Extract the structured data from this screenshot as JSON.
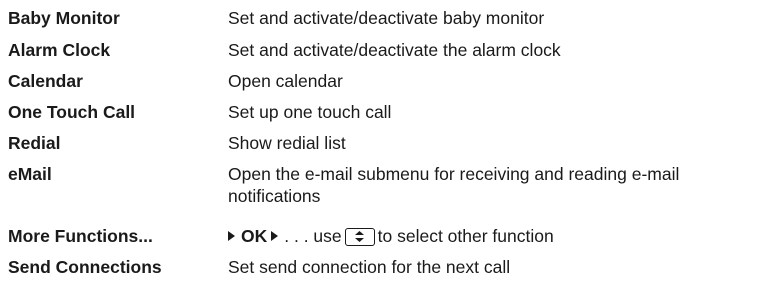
{
  "rows": [
    {
      "label": "Baby Monitor",
      "description": "Set and activate/deactivate baby monitor"
    },
    {
      "label": "Alarm Clock",
      "description": "Set and activate/deactivate the alarm clock"
    },
    {
      "label": "Calendar",
      "description": "Open calendar"
    },
    {
      "label": "One Touch Call",
      "description": "Set up one touch call"
    },
    {
      "label": "Redial",
      "description": "Show redial list"
    },
    {
      "label": "eMail",
      "description": "Open the e-mail submenu for receiving and reading e-mail notifications"
    },
    {
      "label": "More Functions...",
      "ok": "OK",
      "desc_a": ". . . use",
      "desc_b": "to select other function",
      "key_icon": "navigation-key-up-down-icon"
    },
    {
      "label": "Send Connections",
      "description": "Set send connection for the next call"
    }
  ]
}
